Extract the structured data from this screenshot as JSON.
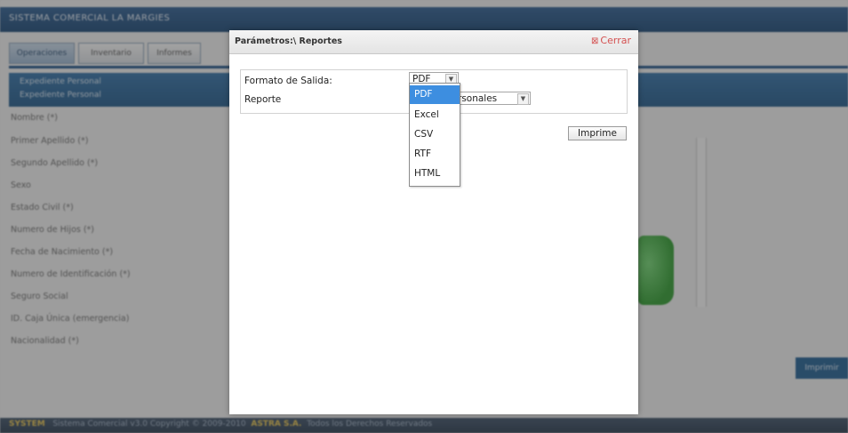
{
  "app": {
    "title": "SISTEMA COMERCIAL LA MARGIES",
    "tabs": [
      "Operaciones",
      "Inventario",
      "Informes"
    ],
    "section_lines": [
      "Expediente Personal",
      "Expediente Personal"
    ],
    "field_labels": [
      "Nombre (*)",
      "Primer Apellido (*)",
      "Segundo Apellido (*)",
      "Sexo",
      "Estado Civil (*)",
      "Numero de Hijos (*)",
      "Fecha de Nacimiento (*)",
      "Numero de Identificación (*)",
      "Seguro Social",
      "ID. Caja Única (emergencia)",
      "Nacionalidad (*)"
    ],
    "side_button": "Imprimir",
    "footer": {
      "brand": "SYSTEM",
      "text": "Sistema Comercial v3.0 Copyright © 2009-2010",
      "company": "ASTRA S.A.",
      "suffix": "Todos los Derechos Reservados"
    }
  },
  "dialog": {
    "title": "Parámetros:\\ Reportes",
    "close_label": "Cerrar",
    "params": {
      "format_label": "Formato de Salida:",
      "format_value": "PDF",
      "report_label": "Reporte",
      "report_value": "rsonales"
    },
    "format_options": [
      "PDF",
      "Excel",
      "CSV",
      "RTF",
      "HTML"
    ],
    "selected_option": "PDF",
    "print_button": "Imprime"
  },
  "colors": {
    "app_header": "#174573",
    "dropdown_highlight": "#3d8ee0",
    "close_text": "#d45050",
    "overlay": "#373737"
  },
  "icons": {
    "close": "close-x-icon",
    "select_arrow": "chevron-down-icon"
  }
}
